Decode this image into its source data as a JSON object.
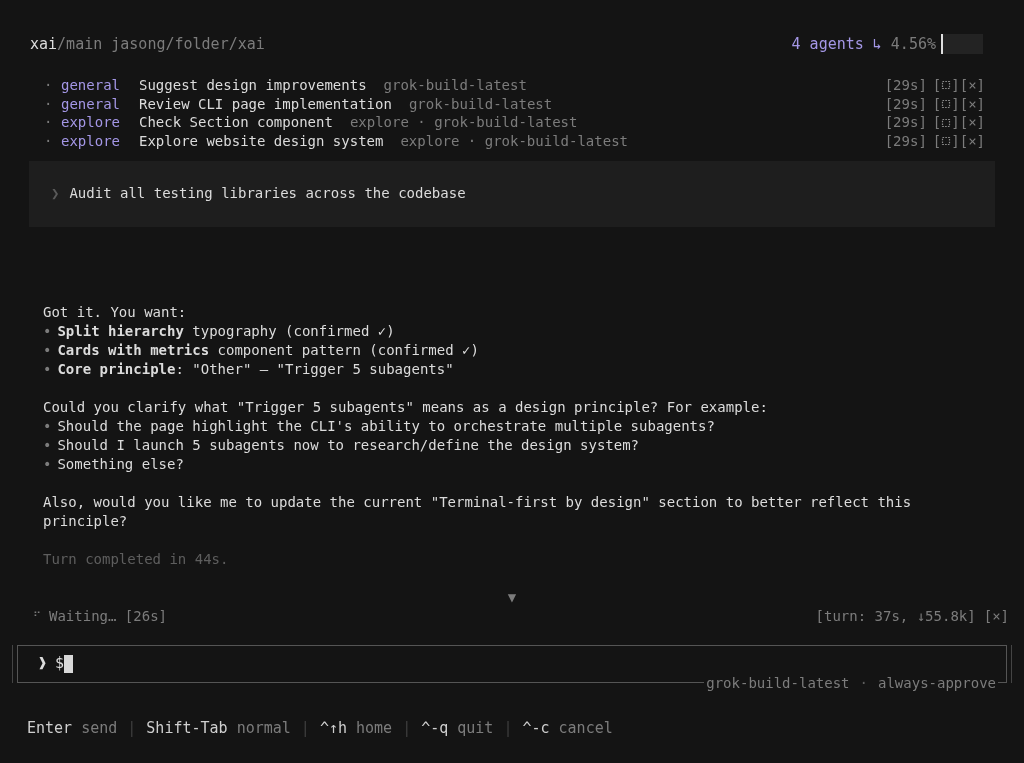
{
  "header": {
    "repo": "xai",
    "branch": "/main",
    "path": "jasong/folder/xai",
    "agents": "4 agents",
    "arrow": "↳",
    "percent": "4.56%",
    "level": 0.05
  },
  "agents": [
    {
      "bullet": "·",
      "type": "general",
      "title": "Suggest design improvements",
      "model": "grok-build-latest",
      "time": "[29s]",
      "expand_open": "[",
      "expand_close": "]",
      "close": "[×]"
    },
    {
      "bullet": "·",
      "type": "general",
      "title": "Review CLI page implementation",
      "model": "grok-build-latest",
      "time": "[29s]",
      "expand_open": "[",
      "expand_close": "]",
      "close": "[×]"
    },
    {
      "bullet": "·",
      "type": "explore",
      "title": "Check Section component",
      "model": "explore · grok-build-latest",
      "time": "[29s]",
      "expand_open": "[",
      "expand_close": "]",
      "close": "[×]"
    },
    {
      "bullet": "·",
      "type": "explore",
      "title": "Explore website design system",
      "model": "explore · grok-build-latest",
      "time": "[29s]",
      "expand_open": "[",
      "expand_close": "]",
      "close": "[×]"
    }
  ],
  "user_prompt": {
    "marker": "❯",
    "text": "Audit all testing libraries across the codebase"
  },
  "response": {
    "blocks": [
      {
        "kind": "text",
        "text": "Got it. You want:"
      },
      {
        "kind": "bullet",
        "bullet": "•",
        "text": "**Split hierarchy** typography (confirmed ✓)"
      },
      {
        "kind": "bullet",
        "bullet": "•",
        "text": "**Cards with metrics** component pattern (confirmed ✓)"
      },
      {
        "kind": "bullet",
        "bullet": "•",
        "text": "**Core principle**: \"Other\" — \"Trigger 5 subagents\""
      },
      {
        "kind": "gap"
      },
      {
        "kind": "text",
        "text": "Could you clarify what \"Trigger 5 subagents\" means as a design principle? For example:"
      },
      {
        "kind": "bullet",
        "bullet": "•",
        "text": "Should the page highlight the CLI's ability to orchestrate multiple subagents?"
      },
      {
        "kind": "bullet",
        "bullet": "•",
        "text": "Should I launch 5 subagents now to research/define the design system?"
      },
      {
        "kind": "bullet",
        "bullet": "•",
        "text": "Something else?"
      },
      {
        "kind": "gap"
      },
      {
        "kind": "text",
        "text": "Also, would you like me to update the current \"Terminal-first by design\" section to better reflect this principle?"
      },
      {
        "kind": "gap"
      },
      {
        "kind": "dim",
        "text": "Turn completed in 44s."
      }
    ]
  },
  "scroll_marker": "▼",
  "status": {
    "spinner": "⠋",
    "text": "Waiting… [26s]",
    "stats": "[turn: 37s, ↓55.8k]",
    "close": "[×]"
  },
  "input": {
    "marker": "❱",
    "value": "$",
    "model": "grok-build-latest",
    "separator": "·",
    "mode": "always-approve"
  },
  "shortcuts": [
    {
      "key": "Enter",
      "action": "send"
    },
    {
      "key": "Shift-Tab",
      "action": "normal"
    },
    {
      "key": "^↑h",
      "action": "home"
    },
    {
      "key": "^-q",
      "action": "quit"
    },
    {
      "key": "^-c",
      "action": "cancel"
    }
  ],
  "shortcut_separator": "|"
}
